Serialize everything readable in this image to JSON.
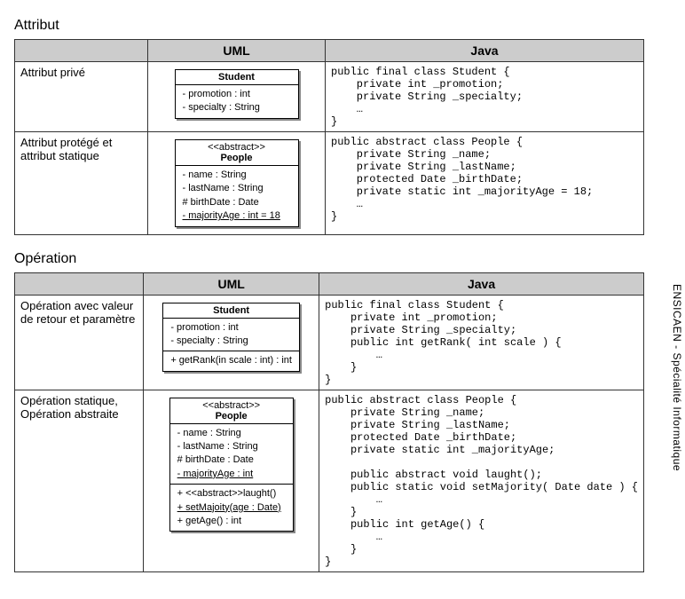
{
  "sideText": "ENSICAEN - Spécialité Informatique",
  "sections": {
    "attribut": {
      "title": "Attribut",
      "headers": {
        "uml": "UML",
        "java": "Java"
      },
      "rows": {
        "r1": {
          "label": "Attribut privé",
          "uml": {
            "className": "Student",
            "attrs": [
              "- promotion : int",
              "- specialty : String"
            ]
          },
          "java": "public final class Student {\n    private int _promotion;\n    private String _specialty;\n    …\n}"
        },
        "r2": {
          "label": "Attribut protégé et attribut statique",
          "uml": {
            "stereo": "<<abstract>>",
            "className": "People",
            "attrs": [
              "- name : String",
              "- lastName : String",
              "# birthDate : Date",
              "- majorityAge : int = 18"
            ],
            "staticIdx": [
              3
            ]
          },
          "java": "public abstract class People {\n    private String _name;\n    private String _lastName;\n    protected Date _birthDate;\n    private static int _majorityAge = 18;\n    …\n}"
        }
      }
    },
    "operation": {
      "title": "Opération",
      "headers": {
        "uml": "UML",
        "java": "Java"
      },
      "rows": {
        "r1": {
          "label": "Opération avec valeur de retour et paramètre",
          "uml": {
            "className": "Student",
            "attrs": [
              "- promotion : int",
              "- specialty : String"
            ],
            "ops": [
              "+ getRank(in scale : int) : int"
            ]
          },
          "java": "public final class Student {\n    private int _promotion;\n    private String _specialty;\n    public int getRank( int scale ) {\n        …\n    }\n}"
        },
        "r2": {
          "label": "Opération statique, Opération abstraite",
          "uml": {
            "stereo": "<<abstract>>",
            "className": "People",
            "attrs": [
              "- name : String",
              "- lastName : String",
              "# birthDate : Date",
              "- majorityAge : int"
            ],
            "staticIdx": [
              3
            ],
            "ops": [
              "+ <<abstract>>laught()",
              "+ setMajoity(age : Date)",
              "+ getAge() : int"
            ],
            "opsStaticIdx": [
              1
            ]
          },
          "java": "public abstract class People {\n    private String _name;\n    private String _lastName;\n    protected Date _birthDate;\n    private static int _majorityAge;\n\n    public abstract void laught();\n    public static void setMajority( Date date ) {\n        …\n    }\n    public int getAge() {\n        …\n    }\n}"
        }
      }
    }
  }
}
